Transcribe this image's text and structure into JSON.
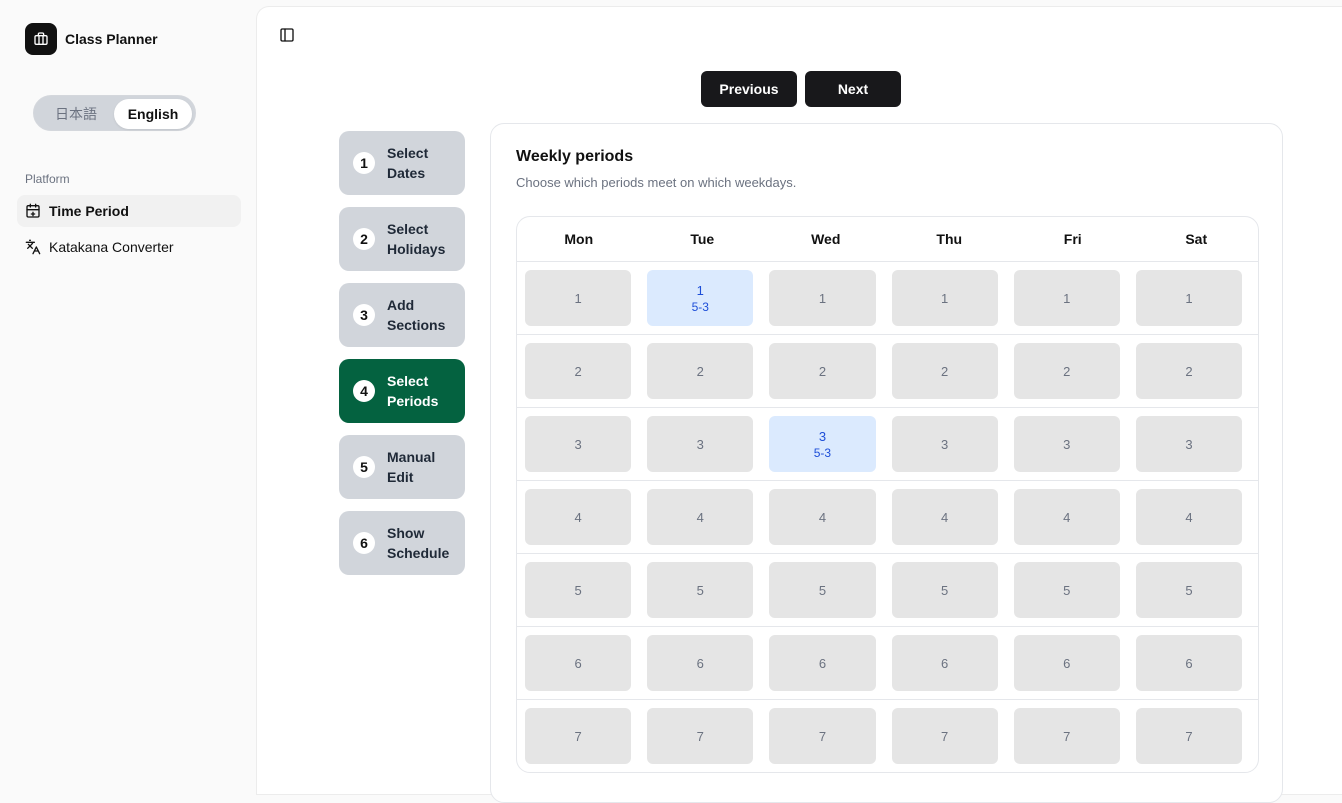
{
  "sidebar": {
    "brand": "Class Planner",
    "language": {
      "ja": "日本語",
      "en": "English",
      "selected": "English"
    },
    "section_label": "Platform",
    "items": [
      {
        "label": "Time Period",
        "icon": "calendar-plus-icon",
        "active": true
      },
      {
        "label": "Katakana Converter",
        "icon": "translate-icon",
        "active": false
      }
    ]
  },
  "toolbar": {
    "previous": "Previous",
    "next": "Next"
  },
  "steps": [
    {
      "num": "1",
      "label": "Select\nDates"
    },
    {
      "num": "2",
      "label": "Select\nHolidays"
    },
    {
      "num": "3",
      "label": "Add\nSections"
    },
    {
      "num": "4",
      "label": "Select\nPeriods",
      "active": true
    },
    {
      "num": "5",
      "label": "Manual\nEdit"
    },
    {
      "num": "6",
      "label": "Show\nSchedule"
    }
  ],
  "card": {
    "title": "Weekly periods",
    "description": "Choose which periods meet on which weekdays."
  },
  "grid": {
    "days": [
      "Mon",
      "Tue",
      "Wed",
      "Thu",
      "Fri",
      "Sat"
    ],
    "periods": [
      "1",
      "2",
      "3",
      "4",
      "5",
      "6",
      "7"
    ],
    "selected": [
      {
        "day": "Tue",
        "period": "1",
        "label": "5-3"
      },
      {
        "day": "Wed",
        "period": "3",
        "label": "5-3"
      }
    ]
  },
  "colors": {
    "active_step": "#046240",
    "selected_cell_bg": "#dbeafe",
    "selected_cell_text": "#1d4ed8",
    "button_bg": "#18181b"
  }
}
